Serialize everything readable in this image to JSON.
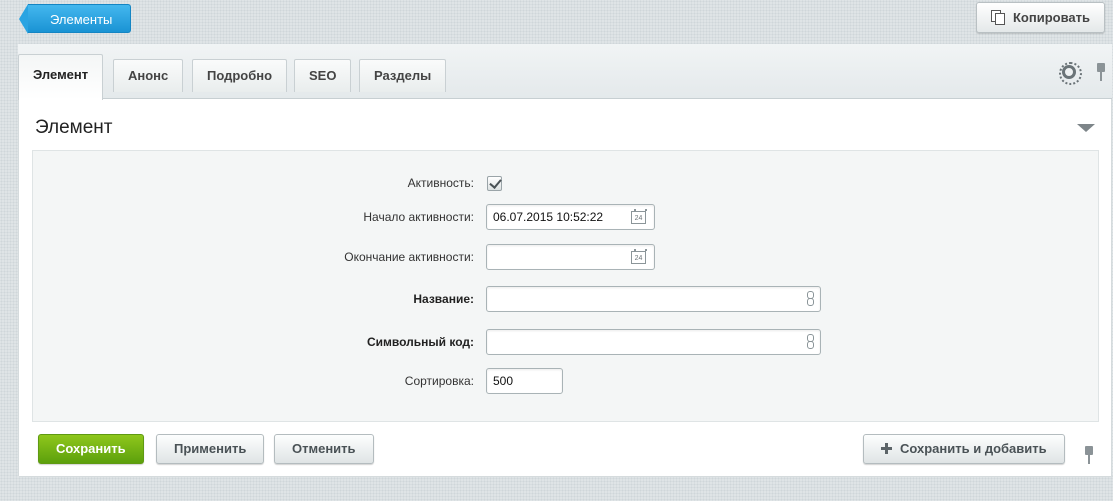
{
  "topbar": {
    "back_label": "Элементы",
    "copy_label": "Копировать"
  },
  "tabs": [
    {
      "label": "Элемент",
      "active": true
    },
    {
      "label": "Анонс",
      "active": false
    },
    {
      "label": "Подробно",
      "active": false
    },
    {
      "label": "SEO",
      "active": false
    },
    {
      "label": "Разделы",
      "active": false
    }
  ],
  "section": {
    "title": "Элемент"
  },
  "form": {
    "active_label": "Активность:",
    "active_checked": true,
    "start_label": "Начало активности:",
    "start_value": "06.07.2015 10:52:22",
    "end_label": "Окончание активности:",
    "end_value": "",
    "name_label": "Название:",
    "name_value": "",
    "code_label": "Символьный код:",
    "code_value": "",
    "sort_label": "Сортировка:",
    "sort_value": "500",
    "calendar_day": "24"
  },
  "actions": {
    "save": "Сохранить",
    "apply": "Применить",
    "cancel": "Отменить",
    "save_add": "Сохранить и добавить"
  },
  "colors": {
    "accent_blue": "#1a93d4",
    "save_green": "#5ca00c"
  },
  "icons": [
    "copy-icon",
    "gear-icon",
    "pin-icon",
    "collapse-icon",
    "calendar-icon",
    "link-icon",
    "plus-icon"
  ]
}
